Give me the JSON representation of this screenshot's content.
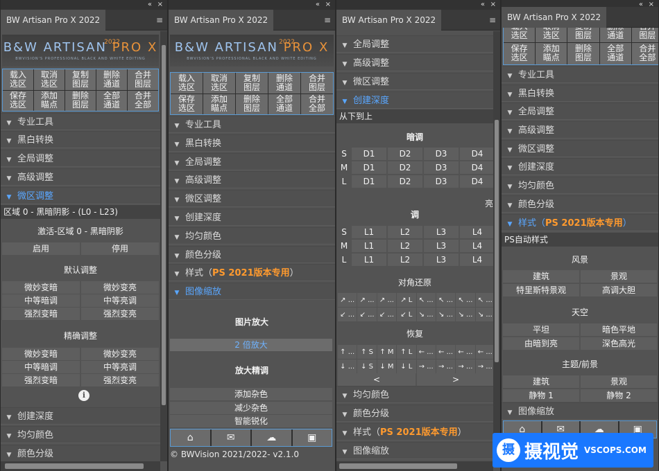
{
  "panel_title": "BW Artisan Pro X 2022",
  "logo": {
    "line1a": "B&W ARTISAN ",
    "line1b": "PRO X",
    "line2": "BWVISION'S PROFESSIONAL BLACK AND WHITE EDITING",
    "year": "2022"
  },
  "window_controls": {
    "collapse": "«",
    "close": "×",
    "menu": "≡"
  },
  "top_buttons": [
    "载入\n选区",
    "取消\n选区",
    "复制\n图层",
    "删除\n通道",
    "合并\n图层",
    "保存\n选区",
    "添加\n瞄点",
    "删除\n图层",
    "全部\n通道",
    "合并\n全部"
  ],
  "sections": {
    "pro_tools": "专业工具",
    "bw_convert": "黑白转换",
    "global_adjust": "全局调整",
    "advanced_adjust": "高级调整",
    "micro_adjust": "微区调整",
    "create_depth": "创建深度",
    "even_color": "均匀颜色",
    "color_grade": "颜色分级",
    "style": "样式（",
    "style_ps": "PS 2021版本专用",
    "style_end": "）",
    "image_zoom": "图像缩放"
  },
  "panel1": {
    "zone_line": "区域 0 - 黑暗阴影 - (L0 - L23)",
    "activate_line": "激活-区域 0 - 黑暗阴影",
    "enable": "启用",
    "disable": "停用",
    "default_adjust": "默认调整",
    "default_buttons": [
      "微妙变暗",
      "微妙变亮",
      "中等暗调",
      "中等亮调",
      "强烈变暗",
      "强烈变亮"
    ],
    "fine_adjust": "精确调整",
    "fine_buttons": [
      "微妙变暗",
      "微妙变亮",
      "中等暗调",
      "中等亮调",
      "强烈变暗",
      "强烈变亮"
    ],
    "info": "i",
    "depth_partial": "颜色分级"
  },
  "panel2": {
    "enlarge_title": "图片放大",
    "enlarge_button": "2 倍放大",
    "refine_title": "放大精调",
    "refine_buttons": [
      "添加杂色",
      "减少杂色",
      "智能锐化"
    ],
    "footer_icons": [
      "home-icon",
      "mail-icon",
      "cloud-download-icon",
      "play-icon"
    ],
    "copyright": "© BWVision 2021/2022- v2.1.0"
  },
  "panel3": {
    "dropdown": "从下到上",
    "dark_tone": "暗调",
    "dark_rows": [
      {
        "label": "S",
        "cells": [
          "D1",
          "D2",
          "D3",
          "D4"
        ]
      },
      {
        "label": "M",
        "cells": [
          "D1",
          "D2",
          "D3",
          "D4"
        ]
      },
      {
        "label": "L",
        "cells": [
          "D1",
          "D2",
          "D3",
          "D4"
        ]
      }
    ],
    "side_char": "亮",
    "tone": "调",
    "light_rows": [
      {
        "label": "S",
        "cells": [
          "L1",
          "L2",
          "L3",
          "L4"
        ]
      },
      {
        "label": "M",
        "cells": [
          "L1",
          "L2",
          "L3",
          "L4"
        ]
      },
      {
        "label": "L",
        "cells": [
          "L1",
          "L2",
          "L3",
          "L4"
        ]
      }
    ],
    "diagonal_restore": "对角还原",
    "diagonal_buttons": [
      "↗ ...",
      "↗ ...",
      "↗ ...",
      "↗ L",
      "↖ ...",
      "↖ ...",
      "↖ ...",
      "↖ ...",
      "↙ ...",
      "↙ ...",
      "↙ ...",
      "↙ L",
      "↘ ...",
      "↘ ...",
      "↘ ...",
      "↘ ..."
    ],
    "restore": "恢复",
    "restore_buttons": [
      "↑ ...",
      "↑ S",
      "↑ M",
      "↑ L",
      "← ...",
      "← ...",
      "← ...",
      "← ...",
      "↓ ...",
      "↓ S",
      "↓ M",
      "↓ L",
      "→ ...",
      "→ ...",
      "→ ...",
      "→ ..."
    ],
    "prev": "<",
    "next": ">"
  },
  "panel4": {
    "auto_style": "PS自动样式",
    "landscape": "风景",
    "landscape_buttons": [
      "建筑",
      "景观",
      "特里斯特景观",
      "高调大胆"
    ],
    "sky": "天空",
    "sky_buttons": [
      "平坦",
      "暗色平地",
      "由暗到亮",
      "深色高光"
    ],
    "subject": "主题/前景",
    "subject_buttons": [
      "建筑",
      "景观",
      "静物 1",
      "静物 2"
    ]
  },
  "watermark": {
    "cn": "摄视觉",
    "en": "VSCOPS.COM",
    "logo_char": "摄"
  }
}
